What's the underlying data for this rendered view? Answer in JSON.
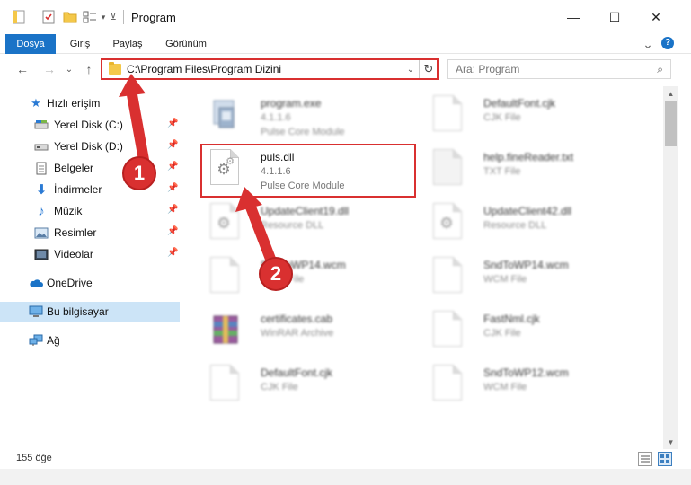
{
  "window": {
    "title": "Program",
    "minimize_glyph": "—",
    "maximize_glyph": "☐",
    "close_glyph": "✕"
  },
  "ribbon": {
    "tabs": [
      "Dosya",
      "Giriş",
      "Paylaş",
      "Görünüm"
    ],
    "expand_glyph": "⌄",
    "help_glyph": "?"
  },
  "nav": {
    "back_glyph": "←",
    "forward_glyph": "→",
    "recent_glyph": "⌄",
    "up_glyph": "↑"
  },
  "address": {
    "path": "C:\\Program Files\\Program Dizini",
    "dropdown_glyph": "⌄",
    "refresh_glyph": "↻"
  },
  "search": {
    "placeholder": "Ara: Program",
    "icon_glyph": "⌕"
  },
  "sidebar": {
    "items": [
      {
        "label": "Hızlı erişim",
        "icon": "star-icon"
      },
      {
        "label": "Yerel Disk (C:)",
        "icon": "drive-icon",
        "pinned": true
      },
      {
        "label": "Yerel Disk (D:)",
        "icon": "drive-icon",
        "pinned": true
      },
      {
        "label": "Belgeler",
        "icon": "documents-icon",
        "pinned": true
      },
      {
        "label": "İndirmeler",
        "icon": "download-icon",
        "pinned": true
      },
      {
        "label": "Müzik",
        "icon": "music-icon",
        "pinned": true
      },
      {
        "label": "Resimler",
        "icon": "pictures-icon",
        "pinned": true
      },
      {
        "label": "Videolar",
        "icon": "videos-icon",
        "pinned": true
      },
      {
        "label": "OneDrive",
        "icon": "cloud-icon"
      },
      {
        "label": "Bu bilgisayar",
        "icon": "computer-icon",
        "selected": true
      },
      {
        "label": "Ağ",
        "icon": "network-icon"
      }
    ]
  },
  "files": {
    "left": [
      {
        "name": "program.exe",
        "line1": "4.1.1.6",
        "line2": "Pulse Core Module",
        "blurred": true
      },
      {
        "name": "puls.dll",
        "line1": "4.1.1.6",
        "line2": "Pulse Core Module",
        "blurred": false
      },
      {
        "name": "UpdateClient19.dll",
        "line1": "Resource DLL",
        "line2": "",
        "blurred": true
      },
      {
        "name": "SndToWP14.wcm",
        "line1": "WCM File",
        "line2": "",
        "blurred": true
      },
      {
        "name": "certificates.cab",
        "line1": "WinRAR Archive",
        "line2": "",
        "blurred": true
      },
      {
        "name": "DefaultFont.cjk",
        "line1": "CJK File",
        "line2": "",
        "blurred": true
      }
    ],
    "right": [
      {
        "name": "DefaultFont.cjk",
        "line1": "CJK File",
        "line2": ""
      },
      {
        "name": "help.fineReader.txt",
        "line1": "TXT File",
        "line2": ""
      },
      {
        "name": "UpdateClient42.dll",
        "line1": "Resource DLL",
        "line2": ""
      },
      {
        "name": "SndToWP14.wcm",
        "line1": "WCM File",
        "line2": ""
      },
      {
        "name": "FastNml.cjk",
        "line1": "CJK File",
        "line2": ""
      },
      {
        "name": "SndToWP12.wcm",
        "line1": "WCM File",
        "line2": ""
      }
    ]
  },
  "status": {
    "item_count": "155 öğe"
  },
  "callouts": [
    "1",
    "2"
  ],
  "colors": {
    "accent": "#1a73c7",
    "highlight": "#d93030",
    "selected": "#cce4f7"
  }
}
